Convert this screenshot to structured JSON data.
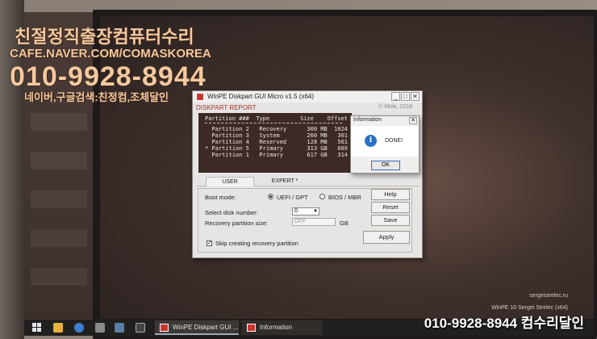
{
  "watermark": {
    "line1": "친절정직출장컴퓨터수리",
    "line2": "CAFE.NAVER.COM/COMASKOREA",
    "phone": "010-9928-8944",
    "line4": "네이버,구글검색:친정컴,조체달인",
    "bottom": "010-9928-8944 컴수리달인"
  },
  "desktop_note": {
    "line1": "sergeistrelec.ru",
    "line2": "WinPE 10 Sergei Strelec (x64)"
  },
  "window": {
    "title": "WinPE Diskpart GUI Micro v1.5 (x64)",
    "min": "_",
    "max": "□",
    "close": "✕",
    "report_label": "DISKPART REPORT",
    "copyright": "© Mole, 2018"
  },
  "report": {
    "header": "Partition ###  Type         Size    Offset",
    "rows": [
      "  Partition 2   Recovery      300 MB  1024 KB",
      "  Partition 3   System        260 MB   301 MB",
      "  Partition 4   Reserved      128 MB   561 MB",
      "* Partition 5   Primary       313 GB   689 MB",
      "  Partition 1   Primary       617 GB   314 GB"
    ]
  },
  "tabs": [
    {
      "label": "USER"
    },
    {
      "label": "EXPERT *"
    }
  ],
  "form": {
    "boot_mode_label": "Boot mode:",
    "uefi_label": "UEFI / GPT",
    "bios_label": "BIOS / MBR",
    "select_disk_label": "Select disk number:",
    "disk_value": "0",
    "recovery_label": "Recovery partition size:",
    "recovery_value": "OFF",
    "recovery_unit": "GB",
    "skip_label": "Skip creating recovery partition",
    "skip_checked": "✓"
  },
  "buttons": {
    "help": "Help",
    "reset": "Reset",
    "save": "Save",
    "apply": "Apply"
  },
  "dialog": {
    "title": "Information",
    "icon": "i",
    "message": "DONE!",
    "ok": "OK",
    "close": "✕"
  },
  "taskbar": {
    "task1": "WinPE Diskpart GUI ...",
    "task2": "Information"
  }
}
